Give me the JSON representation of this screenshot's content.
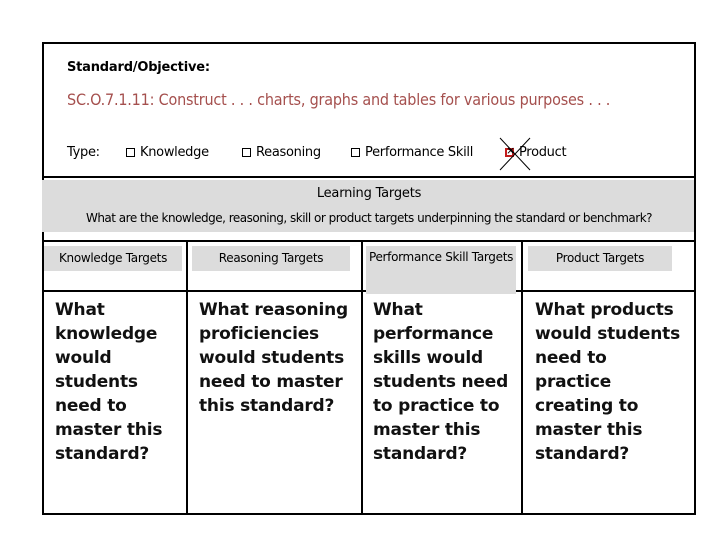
{
  "standard": {
    "label": "Standard/Objective:",
    "text": "SC.O.7.1.11: Construct . . . charts, graphs and tables for various purposes . . ."
  },
  "type": {
    "label": "Type:",
    "options": [
      {
        "label": "Knowledge",
        "checked": false
      },
      {
        "label": "Reasoning",
        "checked": false
      },
      {
        "label": "Performance Skill",
        "checked": false
      },
      {
        "label": "Product",
        "checked": true
      }
    ]
  },
  "learning_targets": {
    "title": "Learning Targets",
    "subtitle": "What are the knowledge, reasoning, skill or product targets underpinning the standard or benchmark?"
  },
  "columns": [
    {
      "header": "Knowledge Targets",
      "body": "What knowledge would students need to master this standard?"
    },
    {
      "header": "Reasoning Targets",
      "body": "What reasoning proficiencies would students need to master this standard?"
    },
    {
      "header": "Performance Skill Targets",
      "body": "What performance skills would students need to practice to master this standard?"
    },
    {
      "header": "Product Targets",
      "body": "What products would students need to practice creating to master this standard?"
    }
  ],
  "colors": {
    "standard_text": "#a5504e",
    "checked_box": "#c21d1d",
    "band_gray": "#dcdcdc"
  }
}
